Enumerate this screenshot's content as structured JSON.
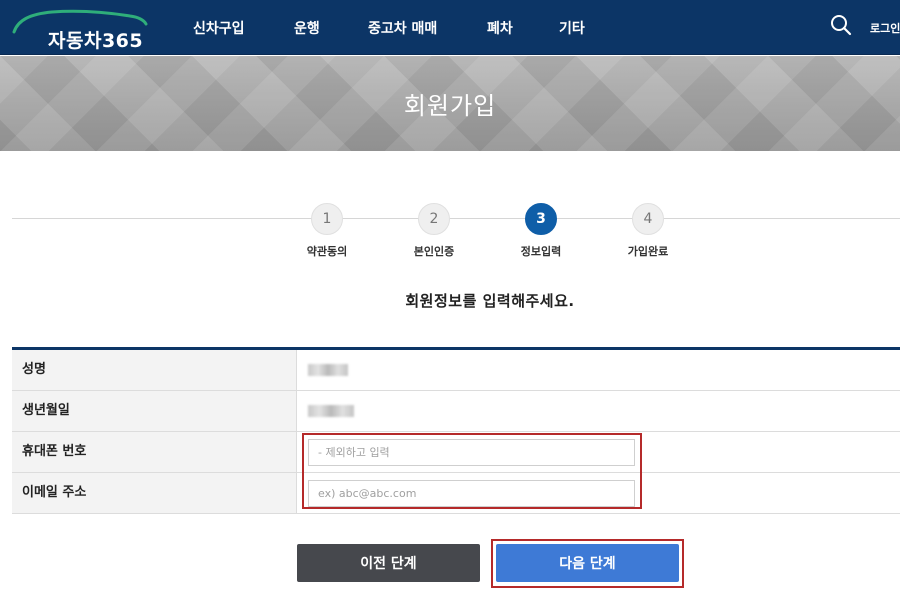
{
  "header": {
    "logo_text": "자동차365",
    "nav": [
      "신차구입",
      "운행",
      "중고차 매매",
      "폐차",
      "기타"
    ],
    "login_label": "로그인",
    "search_icon": "search-icon"
  },
  "banner": {
    "title": "회원가입"
  },
  "steps": [
    {
      "number": "1",
      "label": "약관동의",
      "active": false
    },
    {
      "number": "2",
      "label": "본인인증",
      "active": false
    },
    {
      "number": "3",
      "label": "정보입력",
      "active": true
    },
    {
      "number": "4",
      "label": "가입완료",
      "active": false
    }
  ],
  "instruction": "회원정보를 입력해주세요.",
  "form": {
    "rows": [
      {
        "label": "성명"
      },
      {
        "label": "생년월일"
      },
      {
        "label": "휴대폰 번호",
        "placeholder": "- 제외하고 입력",
        "value": ""
      },
      {
        "label": "이메일 주소",
        "placeholder": "ex) abc@abc.com",
        "value": ""
      }
    ]
  },
  "buttons": {
    "prev_label": "이전 단계",
    "next_label": "다음 단계"
  },
  "colors": {
    "header_bg": "#0c3566",
    "active_step": "#0f5ea8",
    "next_button": "#3e7ad6",
    "prev_button": "#46484d",
    "highlight": "#b52a2a"
  }
}
